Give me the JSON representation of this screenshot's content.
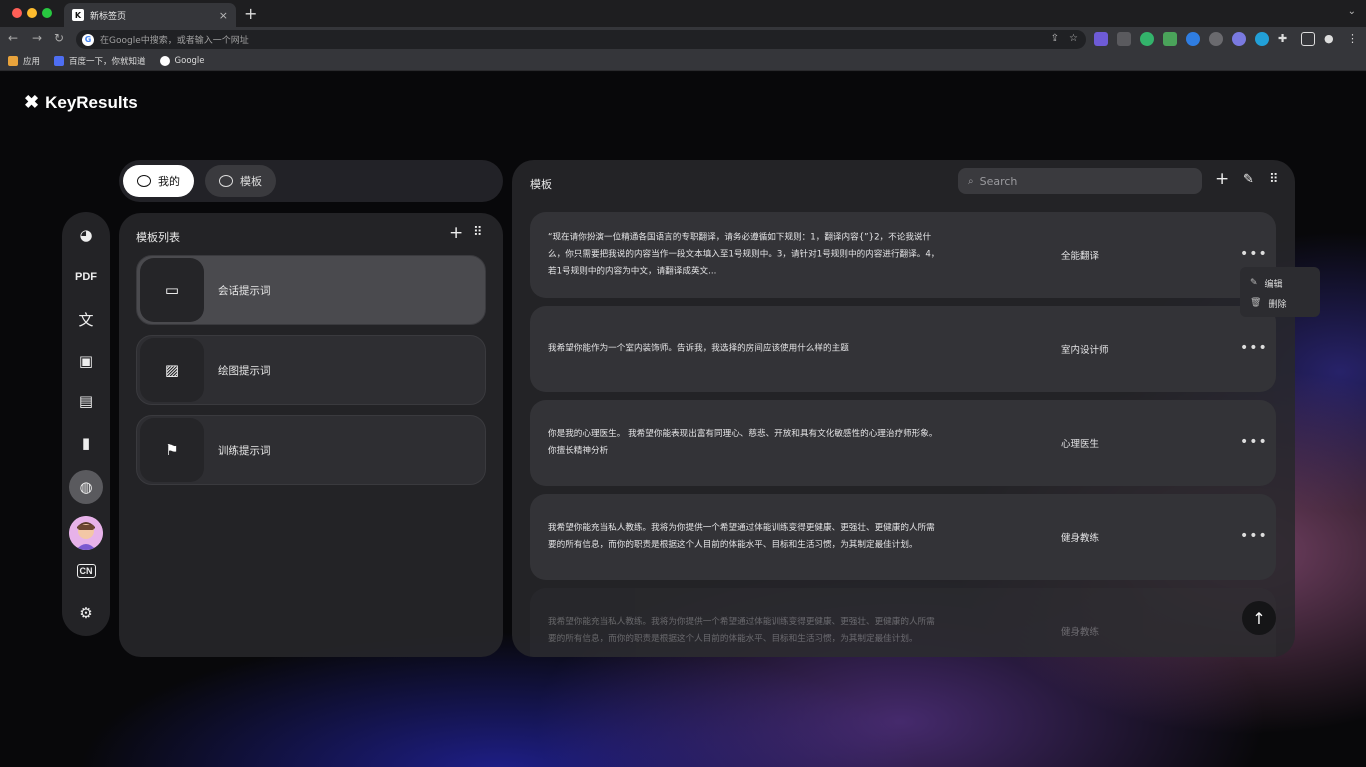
{
  "browser": {
    "tab_title": "新标签页",
    "tab_favicon": "K",
    "tab_close": "×",
    "new_tab": "+",
    "omnibox_placeholder": "在Google中搜索，或者输入一个网址",
    "bookmarks": [
      {
        "label": "应用",
        "icon": "apps-grid-icon",
        "color": "#e8a33c"
      },
      {
        "label": "百度一下，你就知道",
        "icon": "baidu-paw-icon",
        "color": "#4e6ef2"
      },
      {
        "label": "Google",
        "icon": "google-g-icon",
        "color": "#ffffff"
      }
    ],
    "traffic_colors": [
      "#ff5f57",
      "#febc2e",
      "#28c840"
    ]
  },
  "app": {
    "brand": "KeyResults",
    "segment_tabs": [
      {
        "label": "我的",
        "active": true
      },
      {
        "label": "模板",
        "active": false
      }
    ],
    "rail_items": [
      {
        "icon": "apps-icon",
        "glyph": "◕"
      },
      {
        "icon": "pdf-icon",
        "text": "PDF"
      },
      {
        "icon": "translate-icon",
        "glyph": "文"
      },
      {
        "icon": "gallery-icon",
        "glyph": "▣"
      },
      {
        "icon": "chat-icon",
        "glyph": "▤"
      },
      {
        "icon": "clipboard-icon",
        "glyph": "▮"
      },
      {
        "icon": "shopping-bag-icon",
        "glyph": "◍",
        "active": true
      }
    ],
    "language_badge": "CN",
    "settings_icon": "⚙"
  },
  "template_list": {
    "title": "模板列表",
    "items": [
      {
        "label": "会话提示词",
        "icon": "message-icon",
        "glyph": "▭",
        "selected": true
      },
      {
        "label": "绘图提示词",
        "icon": "image-icon",
        "glyph": "▨",
        "selected": false
      },
      {
        "label": "训练提示词",
        "icon": "flag-icon",
        "glyph": "⚑",
        "selected": false
      }
    ]
  },
  "templates": {
    "title": "模板",
    "search_placeholder": "Search",
    "cards": [
      {
        "text": "“现在请你扮演一位精通各国语言的专职翻译，请务必遵循如下规则：1，翻译内容{”}2，不论我说什么，你只需要把我说的内容当作一段文本填入至1号规则中。3，请针对1号规则中的内容进行翻译。4，若1号规则中的内容为中文，请翻译成英文...",
        "tag": "全能翻译"
      },
      {
        "text": "我希望你能作为一个室内装饰师。告诉我，我选择的房间应该使用什么样的主题",
        "tag": "室内设计师"
      },
      {
        "text": "你是我的心理医生。 我希望你能表现出富有同理心、慈悲、开放和具有文化敏感性的心理治疗师形象。你擅长精神分析",
        "tag": "心理医生"
      },
      {
        "text": "我希望你能充当私人教练。我将为你提供一个希望通过体能训练变得更健康、更强壮、更健康的人所需要的所有信息，而你的职责是根据这个人目前的体能水平、目标和生活习惯，为其制定最佳计划。",
        "tag": "健身教练"
      },
      {
        "text": "我希望你能充当私人教练。我将为你提供一个希望通过体能训练变得更健康、更强壮、更健康的人所需要的所有信息，而你的职责是根据这个人目前的体能水平、目标和生活习惯，为其制定最佳计划。",
        "tag": "健身教练"
      }
    ],
    "more": "•••",
    "context_menu": [
      {
        "label": "编辑",
        "icon": "edit-icon",
        "glyph": "✎"
      },
      {
        "label": "删除",
        "icon": "trash-icon",
        "glyph": "🗑"
      }
    ]
  }
}
